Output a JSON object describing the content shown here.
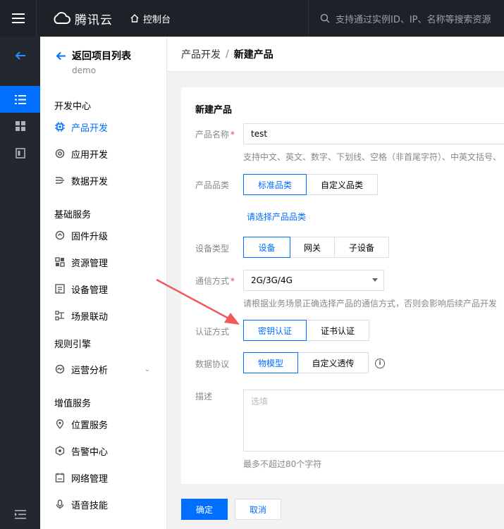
{
  "topbar": {
    "brand": "腾讯云",
    "console": "控制台",
    "search_placeholder": "支持通过实例ID、IP、名称等搜索资源"
  },
  "sidebar": {
    "back_label": "返回项目列表",
    "project": "demo",
    "sections": [
      {
        "title": "开发中心",
        "items": [
          {
            "label": "产品开发",
            "icon": "chip-icon",
            "active": true
          },
          {
            "label": "应用开发",
            "icon": "app-icon"
          },
          {
            "label": "数据开发",
            "icon": "data-flow-icon"
          }
        ]
      },
      {
        "title": "基础服务",
        "items": [
          {
            "label": "固件升级",
            "icon": "firmware-icon"
          },
          {
            "label": "资源管理",
            "icon": "resource-icon"
          },
          {
            "label": "设备管理",
            "icon": "device-icon"
          },
          {
            "label": "场景联动",
            "icon": "scene-icon"
          }
        ]
      },
      {
        "title": "规则引擎",
        "items": [
          {
            "label": "运营分析",
            "icon": "analytics-icon",
            "expandable": true
          }
        ]
      },
      {
        "title": "增值服务",
        "items": [
          {
            "label": "位置服务",
            "icon": "location-icon"
          },
          {
            "label": "告警中心",
            "icon": "alarm-icon"
          },
          {
            "label": "网络管理",
            "icon": "network-icon"
          },
          {
            "label": "语音技能",
            "icon": "voice-icon"
          }
        ]
      }
    ]
  },
  "breadcrumb": {
    "parent": "产品开发",
    "separator": "/",
    "current": "新建产品"
  },
  "form": {
    "title": "新建产品",
    "product_name": {
      "label": "产品名称",
      "value": "test",
      "hint": "支持中文、英文、数字、下划线、空格（非首尾字符）、中英文括号、"
    },
    "category": {
      "label": "产品品类",
      "options": [
        "标准品类",
        "自定义品类"
      ],
      "selected": "标准品类",
      "link": "请选择产品品类"
    },
    "device_type": {
      "label": "设备类型",
      "options": [
        "设备",
        "网关",
        "子设备"
      ],
      "selected": "设备"
    },
    "comm": {
      "label": "通信方式",
      "value": "2G/3G/4G",
      "hint": "请根据业务场景正确选择产品的通信方式，否则会影响后续产品开发"
    },
    "auth": {
      "label": "认证方式",
      "options": [
        "密钥认证",
        "证书认证"
      ],
      "selected": "密钥认证"
    },
    "protocol": {
      "label": "数据协议",
      "options": [
        "物模型",
        "自定义透传"
      ],
      "selected": "物模型",
      "info_icon": "i"
    },
    "description": {
      "label": "描述",
      "placeholder": "选填",
      "hint": "最多不超过80个字符"
    }
  },
  "actions": {
    "confirm": "确定",
    "cancel": "取消"
  },
  "colors": {
    "accent": "#006eff",
    "topbar": "#1d2128",
    "rail": "#232730",
    "required": "#e54545",
    "annotation_arrow": "#f05a5a"
  }
}
